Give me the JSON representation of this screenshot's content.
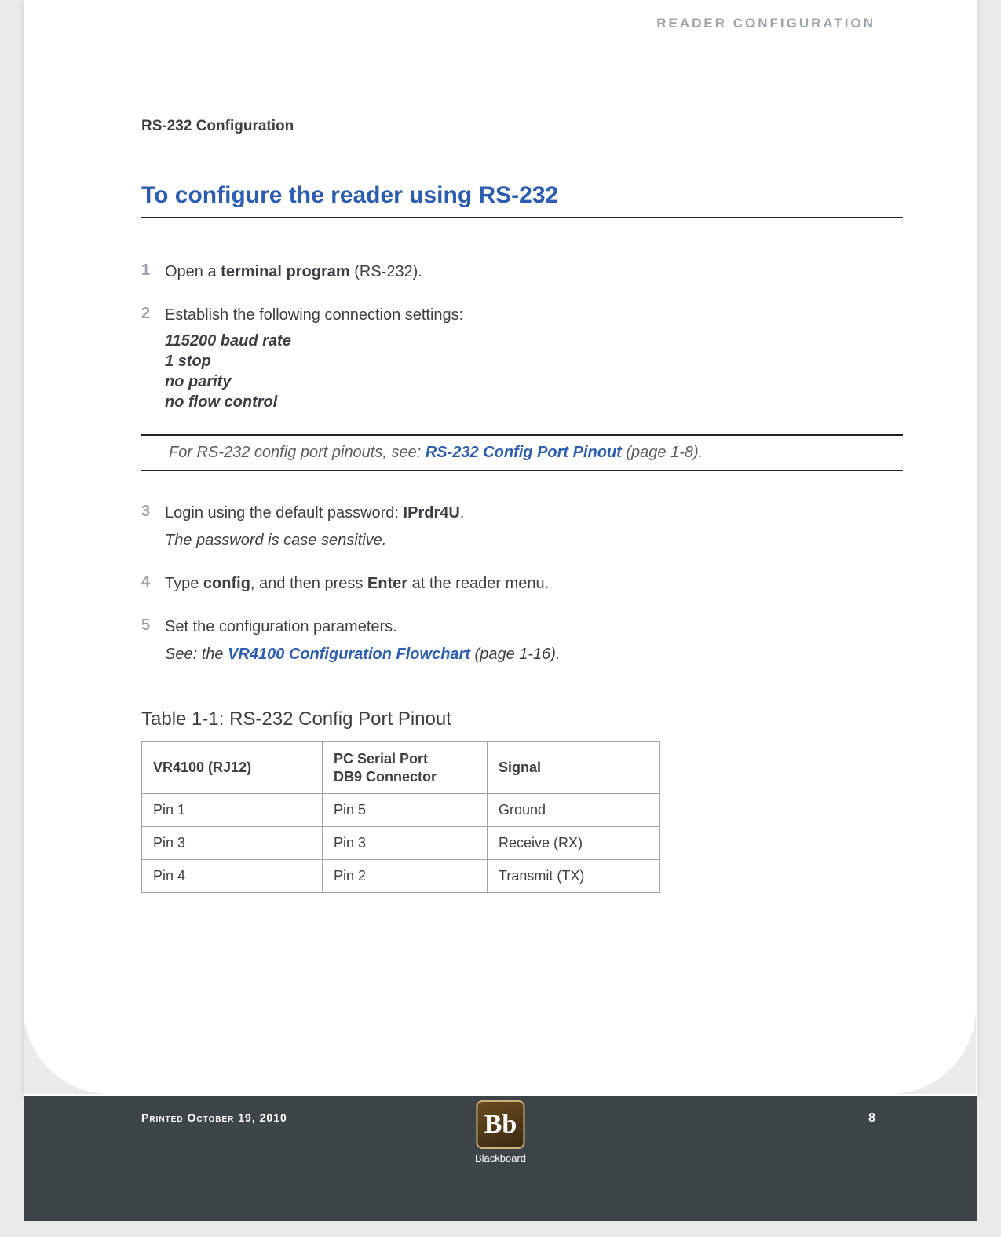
{
  "running_head": "READER  CONFIGURATION",
  "section_subhead": "RS-232 Configuration",
  "title": "To configure the reader using RS-232",
  "steps": {
    "s1": {
      "num": "1",
      "pre": "Open a ",
      "bold": "terminal program",
      "post": " (RS-232)."
    },
    "s2": {
      "num": "2",
      "text": "Establish the following connection settings:",
      "settings": {
        "l1": "115200 baud rate",
        "l2": "1 stop",
        "l3": "no parity",
        "l4": "no flow control"
      }
    },
    "note": {
      "pre": "For RS-232 config port pinouts, see: ",
      "link": "RS-232 Config Port Pinout",
      "post": " (page 1-8)."
    },
    "s3": {
      "num": "3",
      "pre": "Login using the default password: ",
      "bold": "IPrdr4U",
      "post": ".",
      "pwnote": "The password is case sensitive."
    },
    "s4": {
      "num": "4",
      "a": "Type ",
      "b": "config",
      "c": ", and then press ",
      "d": "Enter",
      "e": " at the reader menu."
    },
    "s5": {
      "num": "5",
      "text": "Set the configuration parameters.",
      "see_pre": "See: the ",
      "see_link": "VR4100 Configuration Flowchart",
      "see_post": " (page 1-16)."
    }
  },
  "table": {
    "caption": "Table 1-1: RS-232 Config Port Pinout",
    "head": {
      "c1": "VR4100 (RJ12)",
      "c2a": "PC Serial Port",
      "c2b": "DB9 Connector",
      "c3": "Signal"
    },
    "rows": {
      "r1": {
        "c1": "Pin 1",
        "c2": "Pin 5",
        "c3": "Ground"
      },
      "r2": {
        "c1": "Pin 3",
        "c2": "Pin 3",
        "c3": "Receive (RX)"
      },
      "r3": {
        "c1": "Pin 4",
        "c2": "Pin 2",
        "c3": "Transmit (TX)"
      }
    }
  },
  "footer": {
    "print_date": "Printed October 19, 2010",
    "page_num": "8",
    "logo_bb": "Bb",
    "logo_text": "Blackboard"
  }
}
